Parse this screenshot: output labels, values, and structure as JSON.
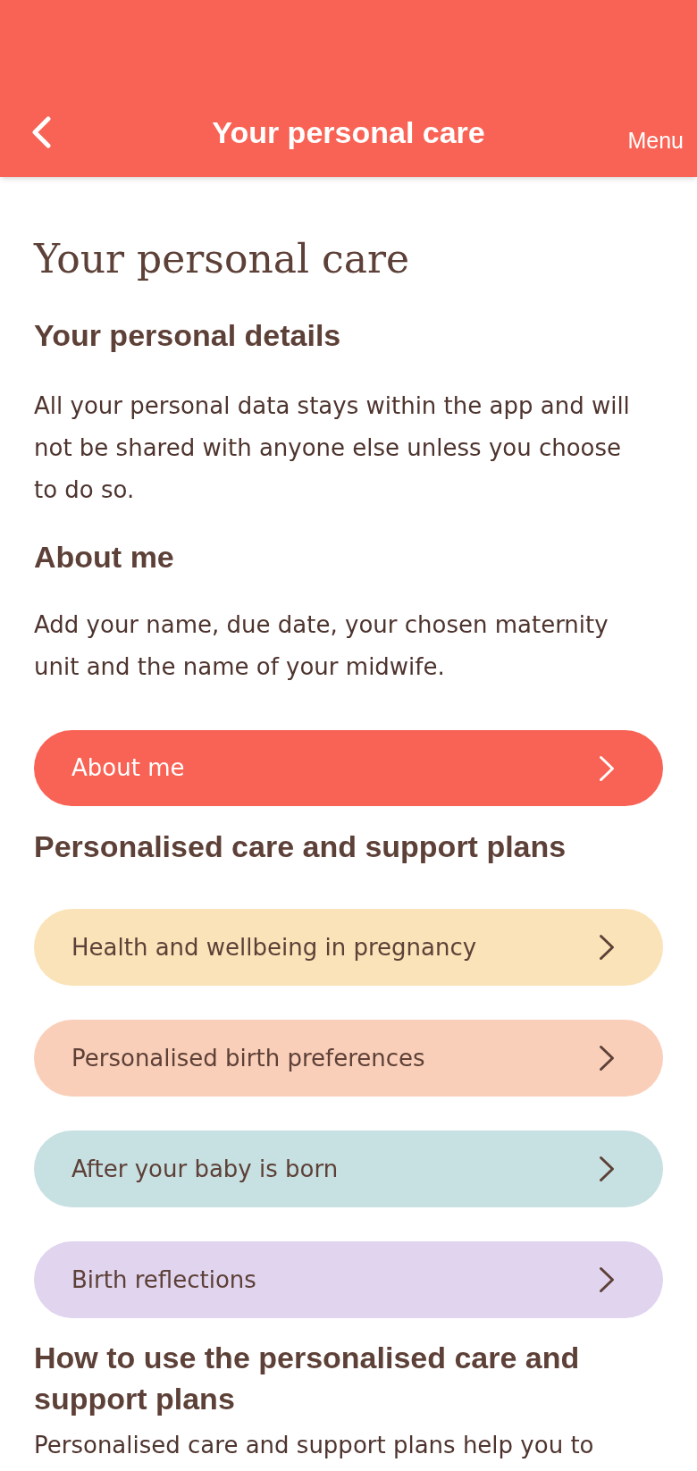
{
  "app_bar": {
    "title": "Your personal care",
    "menu_label": "Menu"
  },
  "page_title": "Your personal care",
  "details": {
    "heading": "Your personal details",
    "text": "All your personal data stays within the app and will not be shared with anyone else unless you choose to do so."
  },
  "about": {
    "heading": "About me",
    "text": "Add your name, due date, your chosen maternity unit and the name of your midwife.",
    "button": "About me"
  },
  "plans": {
    "heading": "Personalised care and support plans",
    "items": [
      {
        "label": "Health and wellbeing in pregnancy",
        "color": "#fae3b8"
      },
      {
        "label": "Personalised birth preferences",
        "color": "#facfba"
      },
      {
        "label": "After your baby is born",
        "color": "#c7e0e2"
      },
      {
        "label": "Birth reflections",
        "color": "#e0d4ef"
      }
    ]
  },
  "how_to": {
    "heading": "How to use the personalised care and support plans",
    "text": "Personalised care and support plans help you to"
  }
}
